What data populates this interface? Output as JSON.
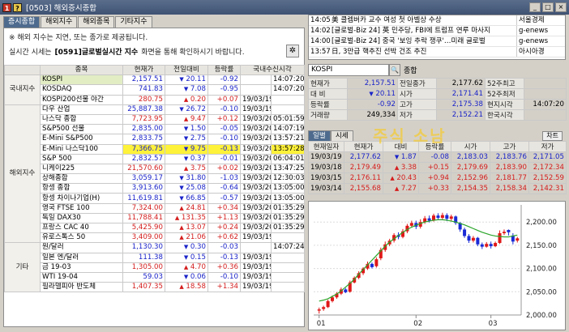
{
  "window": {
    "title": "[0503] 해외증시종합"
  },
  "tabs": [
    "증시종합",
    "해외지수",
    "해외종목",
    "기타지수"
  ],
  "notice": {
    "line1": "※ 해외 지수는 지연, 또는 종가로 제공됩니다.",
    "line2a": "실시간 시세는",
    "line2b": "[0591]글로벌실시간 지수",
    "line2c": "화면을 통해 확인하시기 바랍니다."
  },
  "table": {
    "headers": [
      "종목",
      "현재가",
      "전일대비",
      "등락률",
      "국내수신시각"
    ],
    "groups": [
      {
        "label": "국내지수",
        "rows": [
          {
            "name": "KOSPI",
            "price": "2,157.51",
            "dir": "down",
            "chg": "20.11",
            "rate": "-0.92",
            "date": "",
            "time": "14:07:20",
            "hl": true
          },
          {
            "name": "KOSDAQ",
            "price": "741.83",
            "dir": "down",
            "chg": "7.08",
            "rate": "-0.95",
            "date": "",
            "time": "14:07:20"
          },
          {
            "name": "KOSPI200선물 야간",
            "price": "280.75",
            "dir": "up",
            "chg": "0.20",
            "rate": "+0.07",
            "date": "19/03/19",
            "time": ""
          }
        ]
      },
      {
        "label": "해외지수",
        "rows": [
          {
            "name": "다우 산업",
            "price": "25,887.38",
            "dir": "down",
            "chg": "26.72",
            "rate": "-0.10",
            "date": "19/03/19",
            "time": ""
          },
          {
            "name": "나스닥 종합",
            "price": "7,723.95",
            "dir": "up",
            "chg": "9.47",
            "rate": "+0.12",
            "date": "19/03/20",
            "time": "05:01:59"
          },
          {
            "name": "S&P500 선물",
            "price": "2,835.00",
            "dir": "down",
            "chg": "1.50",
            "rate": "-0.05",
            "date": "19/03/20",
            "time": "14:07:19"
          },
          {
            "name": "E-Mini S&P500",
            "price": "2,833.75",
            "dir": "down",
            "chg": "2.75",
            "rate": "-0.10",
            "date": "19/03/20",
            "time": "13:57:21"
          },
          {
            "name": "E-Mini 나스닥100",
            "price": "7,366.75",
            "dir": "down",
            "chg": "9.75",
            "rate": "-0.13",
            "date": "19/03/20",
            "time": "13:57:28",
            "yl": true
          },
          {
            "name": "S&P 500",
            "price": "2,832.57",
            "dir": "down",
            "chg": "0.37",
            "rate": "-0.01",
            "date": "19/03/20",
            "time": "06:04:01"
          },
          {
            "name": "니케이225",
            "price": "21,570.60",
            "dir": "up",
            "chg": "3.75",
            "rate": "+0.02",
            "date": "19/03/20",
            "time": "13:47:25"
          },
          {
            "name": "상해종합",
            "price": "3,059.17",
            "dir": "down",
            "chg": "31.80",
            "rate": "-1.03",
            "date": "19/03/20",
            "time": "12:30:03"
          },
          {
            "name": "항셍 종합",
            "price": "3,913.60",
            "dir": "down",
            "chg": "25.08",
            "rate": "-0.64",
            "date": "19/03/20",
            "time": "13:05:00"
          },
          {
            "name": "항셍 차이나기업(H)",
            "price": "11,619.81",
            "dir": "down",
            "chg": "66.85",
            "rate": "-0.57",
            "date": "19/03/20",
            "time": "13:05:00"
          },
          {
            "name": "영국 FTSE 100",
            "price": "7,324.00",
            "dir": "up",
            "chg": "24.81",
            "rate": "+0.34",
            "date": "19/03/20",
            "time": "01:35:29"
          },
          {
            "name": "독일 DAX30",
            "price": "11,788.41",
            "dir": "up",
            "chg": "131.35",
            "rate": "+1.13",
            "date": "19/03/20",
            "time": "01:35:29"
          },
          {
            "name": "프랑스 CAC 40",
            "price": "5,425.90",
            "dir": "up",
            "chg": "13.07",
            "rate": "+0.24",
            "date": "19/03/20",
            "time": "01:35:29"
          },
          {
            "name": "유로스톡스 50",
            "price": "3,409.00",
            "dir": "up",
            "chg": "21.06",
            "rate": "+0.62",
            "date": "19/03/19",
            "time": ""
          }
        ]
      },
      {
        "label": "기타",
        "rows": [
          {
            "name": "원/달러",
            "price": "1,130.30",
            "dir": "down",
            "chg": "0.30",
            "rate": "-0.03",
            "date": "",
            "time": "14:07:24"
          },
          {
            "name": "일본 엔/달러",
            "price": "111.38",
            "dir": "down",
            "chg": "0.15",
            "rate": "-0.13",
            "date": "19/03/19",
            "time": ""
          },
          {
            "name": "금 19-03",
            "price": "1,305.00",
            "dir": "up",
            "chg": "4.70",
            "rate": "+0.36",
            "date": "19/03/19",
            "time": ""
          },
          {
            "name": "WTI 19-04",
            "price": "59.03",
            "dir": "down",
            "chg": "0.06",
            "rate": "-0.10",
            "date": "19/03/19",
            "time": ""
          },
          {
            "name": "필라델피아 반도체",
            "price": "1,407.35",
            "dir": "up",
            "chg": "18.58",
            "rate": "+1.34",
            "date": "19/03/19",
            "time": ""
          }
        ]
      }
    ]
  },
  "news": [
    {
      "time": "14:05",
      "headline": "美 클렘버카 교수 여성 첫 아벨상 수상",
      "source": "서울경제"
    },
    {
      "time": "14:02",
      "headline": "[글로벌-Biz 24] 英 민주당, FBI에 트럼프 연루 마사지",
      "source": "g-enews"
    },
    {
      "time": "14:00",
      "headline": "[글로벌-Biz 24] 중국 '보잉 추락 쟁쿠'…미래 글로벌",
      "source": "g-enews"
    },
    {
      "time": "13:57",
      "headline": "日, 3만급 핵추진 선박 건조 추진",
      "source": "아시아경"
    }
  ],
  "quote": {
    "symbol": "KOSPI",
    "search_label": "종합",
    "rows": [
      [
        {
          "l": "현재가"
        },
        {
          "v": "2,157.51",
          "c": "dn"
        },
        {
          "l": "전일종가"
        },
        {
          "v": "2,177.62"
        },
        {
          "l": "52주최고"
        },
        {
          "v": ""
        }
      ],
      [
        {
          "l": "대 비"
        },
        {
          "v": "20.11",
          "c": "dn",
          "arrow": "▼"
        },
        {
          "l": "시가"
        },
        {
          "v": "2,171.41",
          "c": "dn"
        },
        {
          "l": "52주최저"
        },
        {
          "v": ""
        }
      ],
      [
        {
          "l": "등락률"
        },
        {
          "v": "-0.92",
          "c": "dn"
        },
        {
          "l": "고가"
        },
        {
          "v": "2,175.38",
          "c": "dn"
        },
        {
          "l": "현지시각"
        },
        {
          "v": "14:07:20"
        }
      ],
      [
        {
          "l": "거래량"
        },
        {
          "v": "249,334"
        },
        {
          "l": "저가"
        },
        {
          "v": "2,152.21",
          "c": "dn"
        },
        {
          "l": "한국시각"
        },
        {
          "v": ""
        }
      ]
    ]
  },
  "subtabs": [
    "일별",
    "시세"
  ],
  "chart_btn": "차트",
  "daily": {
    "headers": [
      "현재일자",
      "현재가",
      "대비",
      "등락률",
      "시가",
      "고가",
      "저가"
    ],
    "rows": [
      {
        "date": "19/03/19",
        "price": "2,177.62",
        "dir": "down",
        "chg": "1.87",
        "rate": "-0.08",
        "open": "2,183.03",
        "high": "2,183.76",
        "low": "2,171.05"
      },
      {
        "date": "19/03/18",
        "price": "2,179.49",
        "dir": "up",
        "chg": "3.38",
        "rate": "+0.15",
        "open": "2,179.69",
        "high": "2,183.90",
        "low": "2,172.34"
      },
      {
        "date": "19/03/15",
        "price": "2,176.11",
        "dir": "up",
        "chg": "20.43",
        "rate": "+0.94",
        "open": "2,152.96",
        "high": "2,181.77",
        "low": "2,152.59"
      },
      {
        "date": "19/03/14",
        "price": "2,155.68",
        "dir": "up",
        "chg": "7.27",
        "rate": "+0.33",
        "open": "2,154.35",
        "high": "2,158.34",
        "low": "2,142.31"
      }
    ]
  },
  "watermark": "주식 소남",
  "chart_data": {
    "type": "candlestick",
    "ylim": [
      2000,
      2230
    ],
    "yticks": [
      "2,200.00",
      "2,150.00",
      "2,100.00",
      "2,050.00",
      "2,000.00"
    ],
    "xticks": [
      "01",
      "02",
      "03"
    ],
    "ma": [
      2030,
      2032,
      2035,
      2040,
      2045,
      2052,
      2060,
      2068,
      2077,
      2088,
      2098,
      2108,
      2118,
      2128,
      2138,
      2148,
      2157,
      2164,
      2171,
      2178,
      2184,
      2189,
      2193,
      2197,
      2200,
      2202,
      2204,
      2205,
      2205,
      2204,
      2202,
      2200,
      2197,
      2194,
      2190,
      2186,
      2182,
      2178,
      2175,
      2172,
      2170,
      2169,
      2168,
      2168,
      2170,
      2172
    ],
    "candles": [
      [
        2010,
        2012,
        2003,
        2016
      ],
      [
        2013,
        2017,
        2009,
        2020
      ],
      [
        2017,
        2030,
        2015,
        2033
      ],
      [
        2030,
        2038,
        2027,
        2042
      ],
      [
        2038,
        2046,
        2035,
        2049
      ],
      [
        2046,
        2055,
        2043,
        2059
      ],
      [
        2055,
        2049,
        2047,
        2058
      ],
      [
        2050,
        2070,
        2048,
        2074
      ],
      [
        2070,
        2080,
        2068,
        2083
      ],
      [
        2080,
        2090,
        2077,
        2094
      ],
      [
        2090,
        2100,
        2086,
        2103
      ],
      [
        2100,
        2110,
        2097,
        2115
      ],
      [
        2110,
        2103,
        2100,
        2113
      ],
      [
        2105,
        2120,
        2102,
        2124
      ],
      [
        2122,
        2140,
        2118,
        2145
      ],
      [
        2140,
        2152,
        2136,
        2158
      ],
      [
        2152,
        2160,
        2148,
        2164
      ],
      [
        2160,
        2172,
        2156,
        2176
      ],
      [
        2172,
        2168,
        2163,
        2178
      ],
      [
        2168,
        2180,
        2165,
        2185
      ],
      [
        2180,
        2192,
        2176,
        2196
      ],
      [
        2192,
        2198,
        2188,
        2203
      ],
      [
        2198,
        2190,
        2185,
        2203
      ],
      [
        2190,
        2200,
        2186,
        2206
      ],
      [
        2200,
        2208,
        2196,
        2213
      ],
      [
        2208,
        2203,
        2199,
        2214
      ],
      [
        2203,
        2214,
        2201,
        2218
      ],
      [
        2214,
        2209,
        2204,
        2219
      ],
      [
        2209,
        2215,
        2205,
        2220
      ],
      [
        2215,
        2207,
        2202,
        2219
      ],
      [
        2207,
        2212,
        2203,
        2216
      ],
      [
        2212,
        2198,
        2194,
        2214
      ],
      [
        2198,
        2184,
        2179,
        2200
      ],
      [
        2184,
        2170,
        2166,
        2188
      ],
      [
        2170,
        2160,
        2155,
        2174
      ],
      [
        2160,
        2166,
        2156,
        2170
      ],
      [
        2166,
        2152,
        2148,
        2168
      ],
      [
        2152,
        2147,
        2142,
        2156
      ],
      [
        2147,
        2153,
        2145,
        2157
      ],
      [
        2153,
        2148,
        2143,
        2158
      ],
      [
        2148,
        2155,
        2146,
        2158
      ],
      [
        2155,
        2176,
        2153,
        2182
      ],
      [
        2176,
        2179,
        2172,
        2184
      ],
      [
        2183,
        2178,
        2171,
        2184
      ],
      [
        2171,
        2158,
        2152,
        2176
      ],
      [
        2160,
        2165,
        2156,
        2168
      ]
    ]
  }
}
